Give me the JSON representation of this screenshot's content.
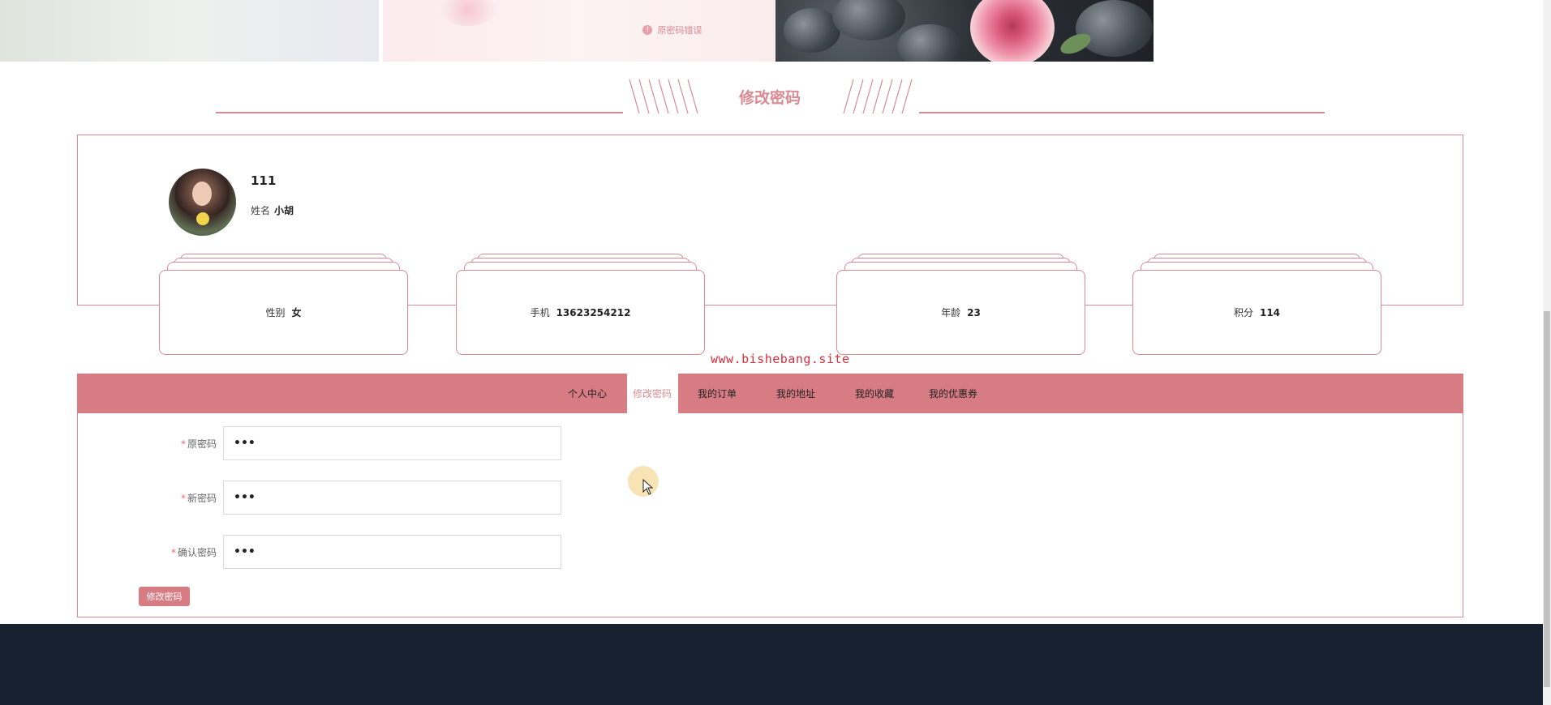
{
  "banner": {
    "notice_text": "原密码错误",
    "notice_icon": "alert-icon"
  },
  "section": {
    "title": "修改密码"
  },
  "profile": {
    "username": "111",
    "name_label": "姓名",
    "name_value": "小胡",
    "cards": [
      {
        "label": "性别",
        "value": "女"
      },
      {
        "label": "手机",
        "value": "13623254212"
      },
      {
        "label": "年龄",
        "value": "23"
      },
      {
        "label": "积分",
        "value": "114"
      }
    ]
  },
  "watermark": "www.bishebang.site",
  "tabs": [
    {
      "label": "个人中心",
      "active": false
    },
    {
      "label": "修改密码",
      "active": true
    },
    {
      "label": "我的订单",
      "active": false
    },
    {
      "label": "我的地址",
      "active": false
    },
    {
      "label": "我的收藏",
      "active": false
    },
    {
      "label": "我的优惠券",
      "active": false
    }
  ],
  "form": {
    "required_mark": "*",
    "fields": [
      {
        "label": "原密码",
        "value": "•••"
      },
      {
        "label": "新密码",
        "value": "•••"
      },
      {
        "label": "确认密码",
        "value": "•••"
      }
    ],
    "submit_label": "修改密码"
  },
  "colors": {
    "accent": "#d98a93",
    "tabbar": "#d87c84",
    "footer": "#16222f",
    "watermark": "#d62e3e"
  }
}
